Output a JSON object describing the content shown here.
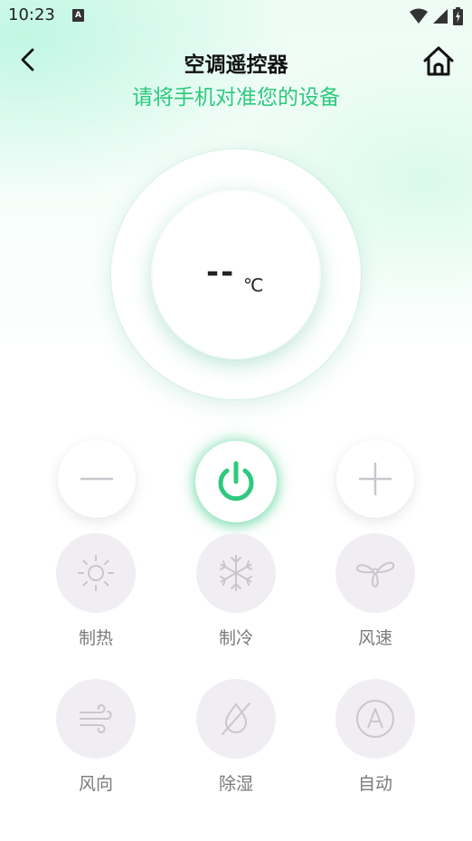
{
  "status_bar": {
    "time": "10:23",
    "notification_glyph": "A"
  },
  "header": {
    "title": "空调遥控器",
    "subtitle": "请将手机对准您的设备"
  },
  "display": {
    "temperature": "--",
    "unit": "℃"
  },
  "colors": {
    "accent": "#2ec97e",
    "icon_gray": "#c9c6cd",
    "label_gray": "#7a7a7a"
  },
  "controls": {
    "minus": {
      "icon": "minus-icon"
    },
    "power": {
      "icon": "power-icon"
    },
    "plus": {
      "icon": "plus-icon"
    }
  },
  "modes": [
    {
      "label": "制热",
      "icon": "sun-icon"
    },
    {
      "label": "制冷",
      "icon": "snowflake-icon"
    },
    {
      "label": "风速",
      "icon": "fan-icon"
    },
    {
      "label": "风向",
      "icon": "wind-icon"
    },
    {
      "label": "除湿",
      "icon": "no-drop-icon"
    },
    {
      "label": "自动",
      "icon": "auto-icon"
    }
  ]
}
